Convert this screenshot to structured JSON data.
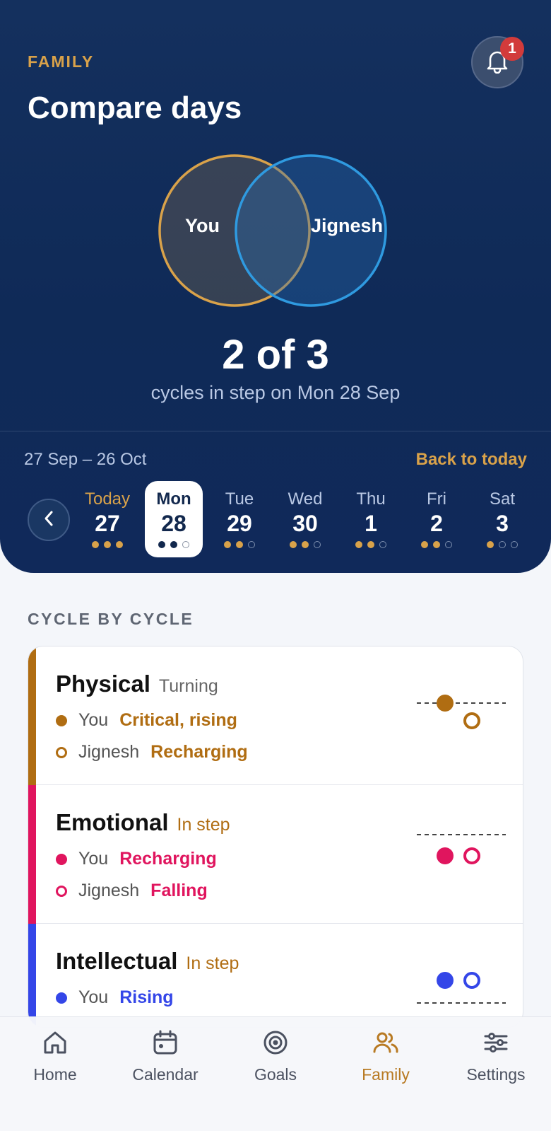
{
  "header": {
    "eyebrow": "FAMILY",
    "title": "Compare days",
    "notification_count": "1"
  },
  "venn": {
    "left_label": "You",
    "right_label": "Jignesh"
  },
  "summary": {
    "count": "2 of 3",
    "subtitle": "cycles in step on Mon 28 Sep"
  },
  "calendar": {
    "range": "27 Sep – 26 Oct",
    "back_label": "Back to today",
    "days": [
      {
        "name": "Today",
        "num": "27",
        "dots": [
          1,
          1,
          1
        ]
      },
      {
        "name": "Mon",
        "num": "28",
        "dots": [
          1,
          1,
          0
        ]
      },
      {
        "name": "Tue",
        "num": "29",
        "dots": [
          1,
          1,
          0
        ]
      },
      {
        "name": "Wed",
        "num": "30",
        "dots": [
          1,
          1,
          0
        ]
      },
      {
        "name": "Thu",
        "num": "1",
        "dots": [
          1,
          1,
          0
        ]
      },
      {
        "name": "Fri",
        "num": "2",
        "dots": [
          1,
          1,
          0
        ]
      },
      {
        "name": "Sat",
        "num": "3",
        "dots": [
          1,
          0,
          0
        ]
      }
    ]
  },
  "cycles": {
    "section_title": "CYCLE BY CYCLE",
    "rows": [
      {
        "name": "Physical",
        "state": "Turning",
        "color": "#b06d12",
        "state_color": "#666666",
        "you_label": "You",
        "you_status": "Critical, rising",
        "other_label": "Jignesh",
        "other_status": "Recharging"
      },
      {
        "name": "Emotional",
        "state": "In step",
        "color": "#e0155e",
        "state_color": "#b06d12",
        "you_label": "You",
        "you_status": "Recharging",
        "other_label": "Jignesh",
        "other_status": "Falling"
      },
      {
        "name": "Intellectual",
        "state": "In step",
        "color": "#3446e8",
        "state_color": "#b06d12",
        "you_label": "You",
        "you_status": "Rising"
      }
    ]
  },
  "tabs": [
    {
      "label": "Home",
      "icon": "home-icon"
    },
    {
      "label": "Calendar",
      "icon": "calendar-icon"
    },
    {
      "label": "Goals",
      "icon": "target-icon"
    },
    {
      "label": "Family",
      "icon": "family-icon",
      "active": true
    },
    {
      "label": "Settings",
      "icon": "sliders-icon"
    }
  ]
}
